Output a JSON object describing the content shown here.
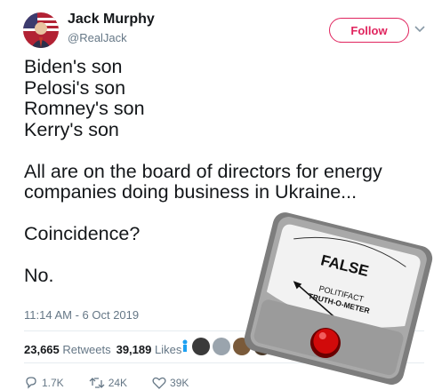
{
  "tweet": {
    "author_name": "Jack Murphy",
    "author_handle": "@RealJack",
    "follow_label": "Follow",
    "lines": [
      "Biden's son",
      "Pelosi's son",
      "Romney's son",
      "Kerry's son",
      "",
      "All are on the board of directors for energy",
      "companies doing business in Ukraine...",
      "",
      "Coincidence?",
      "",
      "No."
    ],
    "timestamp": "11:14 AM - 6 Oct 2019",
    "retweets_count": "23,665",
    "retweets_label": "Retweets",
    "likes_count": "39,189",
    "likes_label": "Likes",
    "reply_count": "1.7K",
    "retweet_action_count": "24K",
    "like_action_count": "39K"
  },
  "overlay": {
    "verdict": "FALSE",
    "brand_line1": "POLITIFACT",
    "brand_line2": "TRUTH-O-METER",
    "colors": {
      "bezel": "#8e8e8e",
      "face": "#f2f2f2",
      "button": "#d10a0a"
    }
  },
  "colors": {
    "follow": "#e0245e",
    "muted": "#657786",
    "text": "#14171a"
  }
}
